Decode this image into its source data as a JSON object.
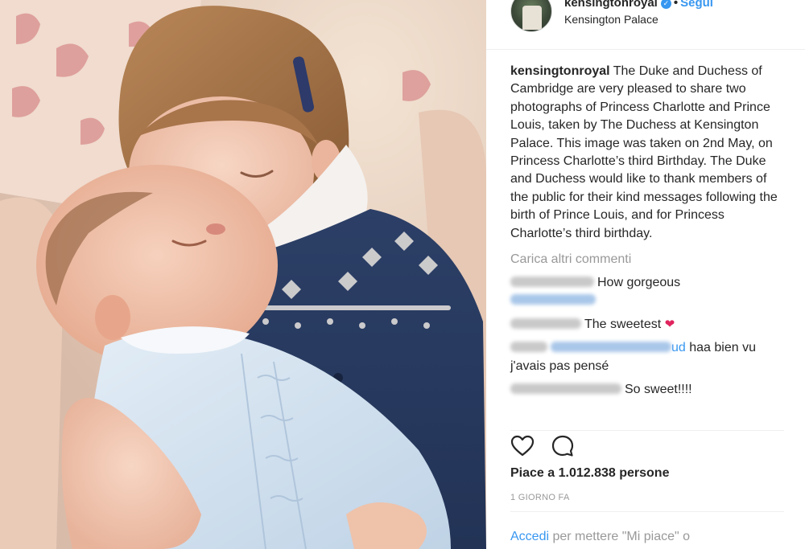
{
  "post": {
    "username": "kensingtonroyal",
    "follow_label": "Segui",
    "location": "Kensington Palace",
    "caption_text": "The Duke and Duchess of Cambridge are very pleased to share two photographs of Princess Charlotte and Prince Louis, taken by The Duchess at Kensington Palace. This image was taken on 2nd May, on Princess Charlotte’s third Birthday. The Duke and Duchess would like to thank members of the public for their kind messages following the birth of Prince Louis, and for Princess Charlotte’s third birthday.",
    "load_more_label": "Carica altri commenti",
    "comments": [
      {
        "text": "How gorgeous"
      },
      {
        "text": "The sweetest"
      },
      {
        "mention_suffix": "ud",
        "text": "haa bien vu j'avais pas pensé"
      },
      {
        "text": "So sweet!!!!"
      }
    ],
    "likes_label": "Piace a 1.012.838 persone",
    "time_ago": "1 GIORNO FA",
    "login_link": "Accedi",
    "login_rest": "per mettere \"Mi piace\" o"
  },
  "icons": {
    "verified": "verified-badge-icon",
    "like": "heart-outline-icon",
    "comment": "speech-bubble-icon",
    "comment_emoji": "red-heart-emoji"
  },
  "colors": {
    "link": "#3897f0",
    "muted": "#999999",
    "text": "#262626",
    "divider": "#efefef"
  }
}
